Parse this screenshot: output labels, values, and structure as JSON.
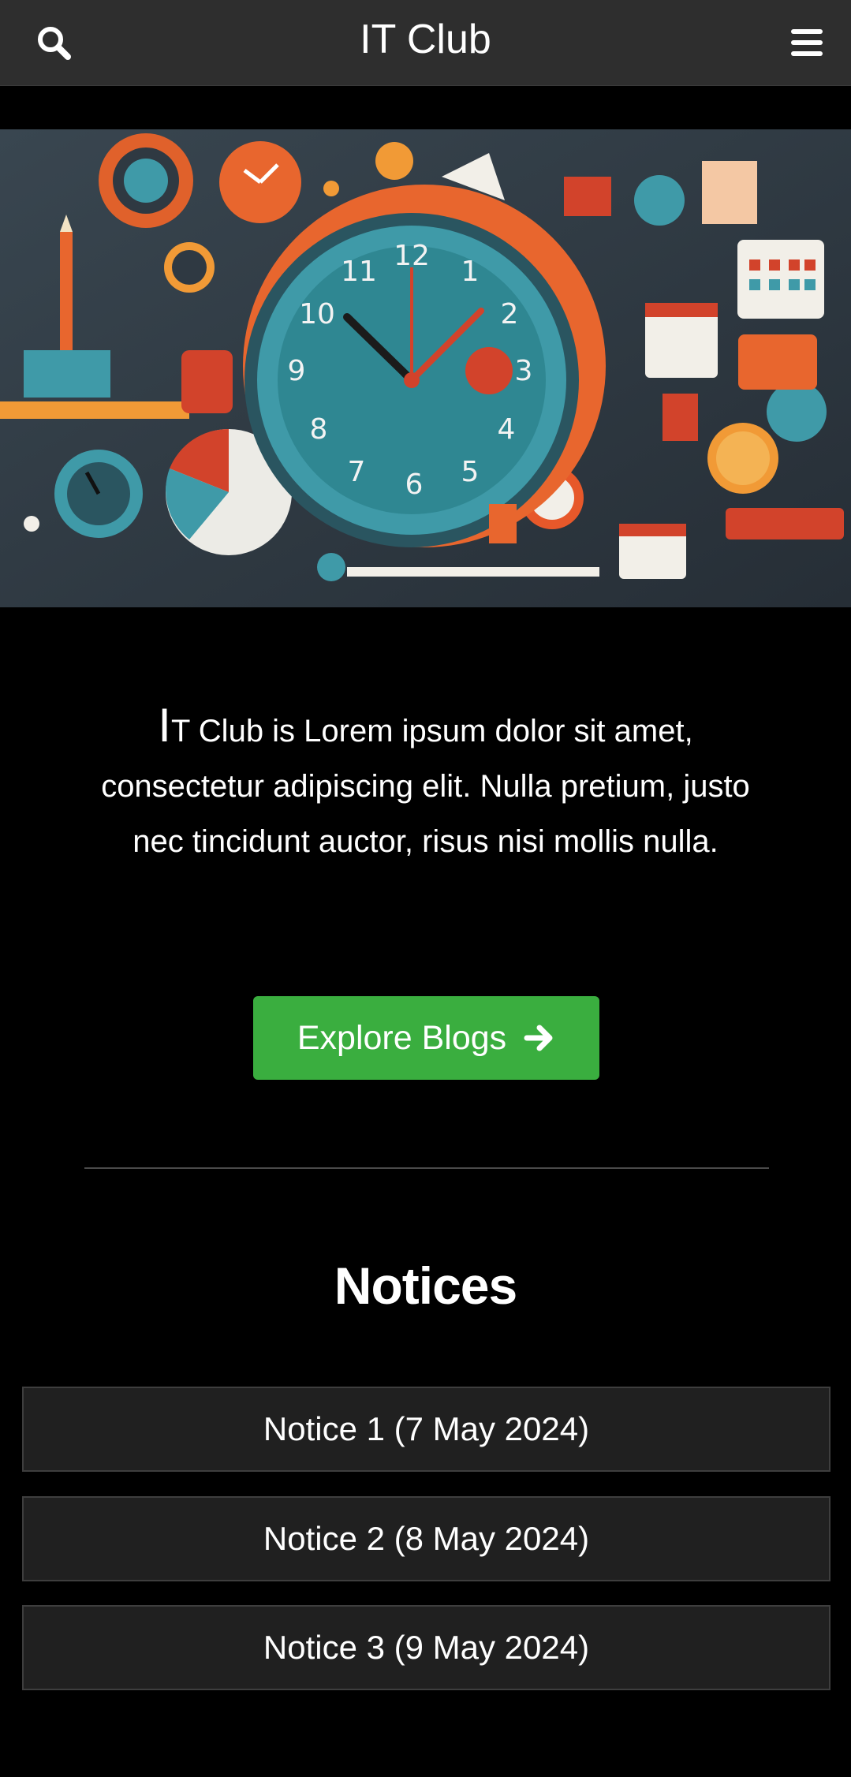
{
  "header": {
    "title": "IT Club",
    "search_icon": "search-icon",
    "menu_icon": "hamburger-menu-icon"
  },
  "hero": {
    "image": "clock-and-calendar-illustration"
  },
  "intro": {
    "dropcap": "I",
    "text": "T Club is Lorem ipsum dolor sit amet, consectetur adipiscing elit. Nulla pretium, justo nec tincidunt auctor, risus nisi mollis nulla."
  },
  "cta": {
    "label": "Explore Blogs",
    "icon": "arrow-right-icon",
    "color": "#3aae3f"
  },
  "notices": {
    "heading": "Notices",
    "items": [
      {
        "label": "Notice 1 (7 May 2024)"
      },
      {
        "label": "Notice 2 (8 May 2024)"
      },
      {
        "label": "Notice 3 (9 May 2024)"
      }
    ]
  }
}
